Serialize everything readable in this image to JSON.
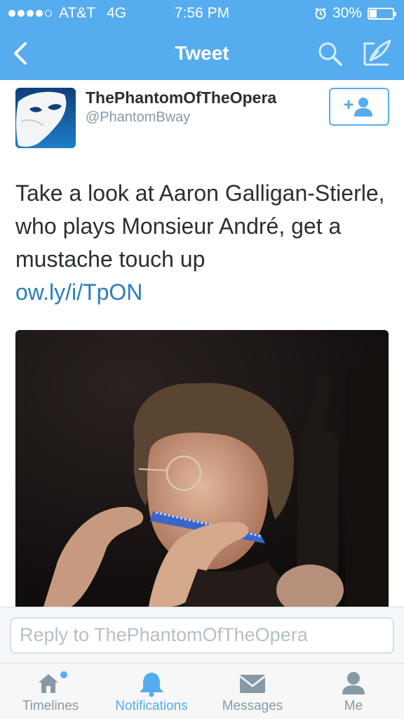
{
  "status_bar": {
    "carrier": "AT&T",
    "network": "4G",
    "time": "7:56 PM",
    "battery": "30%",
    "signal_bars_filled": 4,
    "signal_bars_total": 5
  },
  "nav": {
    "title": "Tweet",
    "back_icon": "chevron-left-icon",
    "search_icon": "search-icon",
    "compose_icon": "compose-icon"
  },
  "tweet": {
    "author_name": "ThePhantomOfTheOpera",
    "author_handle": "@PhantomBway",
    "text": "Take a look at Aaron Galligan-Stierle, who plays Monsieur André, get a mustache touch up",
    "link": "ow.ly/i/TpON",
    "follow_icon": "add-user-icon"
  },
  "reply": {
    "placeholder": "Reply to ThePhantomOfTheOpera"
  },
  "tabs": [
    {
      "label": "Timelines",
      "icon": "home-icon",
      "active": false
    },
    {
      "label": "Notifications",
      "icon": "bell-icon",
      "active": true
    },
    {
      "label": "Messages",
      "icon": "envelope-icon",
      "active": false
    },
    {
      "label": "Me",
      "icon": "person-icon",
      "active": false
    }
  ],
  "colors": {
    "brand_blue": "#55acee",
    "text_dark": "#292f33",
    "text_gray": "#8899a6",
    "link_blue": "#2a7ebf"
  }
}
